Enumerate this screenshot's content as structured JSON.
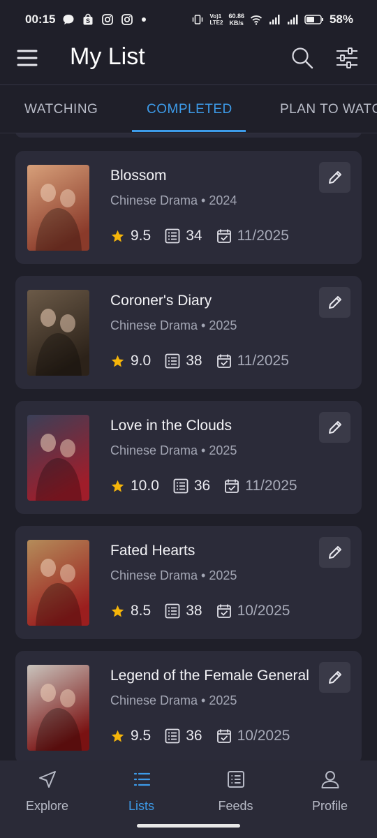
{
  "status_bar": {
    "time": "00:15",
    "net_speed_top": "60.86",
    "net_speed_bottom": "KB/s",
    "vol_top": "Vo)1",
    "vol_bottom": "LTE2",
    "battery": "58%"
  },
  "header": {
    "title": "My List",
    "menu_icon": "hamburger-menu-icon",
    "search_icon": "search-icon",
    "filter_icon": "sliders-icon"
  },
  "tabs": [
    {
      "label": "WATCHING",
      "active": false
    },
    {
      "label": "COMPLETED",
      "active": true
    },
    {
      "label": "PLAN TO WATCH",
      "active": false
    }
  ],
  "items": [
    {
      "title": "Blossom",
      "subtitle": "Chinese Drama • 2024",
      "rating": "9.5",
      "episodes": "34",
      "date": "11/2025",
      "poster_colors": [
        "#d7a07a",
        "#8a3a2a"
      ]
    },
    {
      "title": "Coroner's Diary",
      "subtitle": "Chinese Drama • 2025",
      "rating": "9.0",
      "episodes": "38",
      "date": "11/2025",
      "poster_colors": [
        "#6b5a48",
        "#2c2219"
      ]
    },
    {
      "title": "Love in the Clouds",
      "subtitle": "Chinese Drama • 2025",
      "rating": "10.0",
      "episodes": "36",
      "date": "11/2025",
      "poster_colors": [
        "#3a4058",
        "#a01d2a"
      ]
    },
    {
      "title": "Fated Hearts",
      "subtitle": "Chinese Drama • 2025",
      "rating": "8.5",
      "episodes": "38",
      "date": "10/2025",
      "poster_colors": [
        "#b48c5a",
        "#9b1e1e"
      ]
    },
    {
      "title": "Legend of the Female General",
      "subtitle": "Chinese Drama • 2025",
      "rating": "9.5",
      "episodes": "36",
      "date": "10/2025",
      "poster_colors": [
        "#c9c4bd",
        "#7a1212"
      ]
    }
  ],
  "bottom_nav": [
    {
      "label": "Explore",
      "icon": "navigation-arrow-icon",
      "active": false
    },
    {
      "label": "Lists",
      "icon": "list-icon",
      "active": true
    },
    {
      "label": "Feeds",
      "icon": "feed-icon",
      "active": false
    },
    {
      "label": "Profile",
      "icon": "user-icon",
      "active": false
    }
  ],
  "colors": {
    "accent": "#3d9be9",
    "background": "#1f1f29",
    "card": "#2b2b39",
    "star": "#f5b50a"
  }
}
